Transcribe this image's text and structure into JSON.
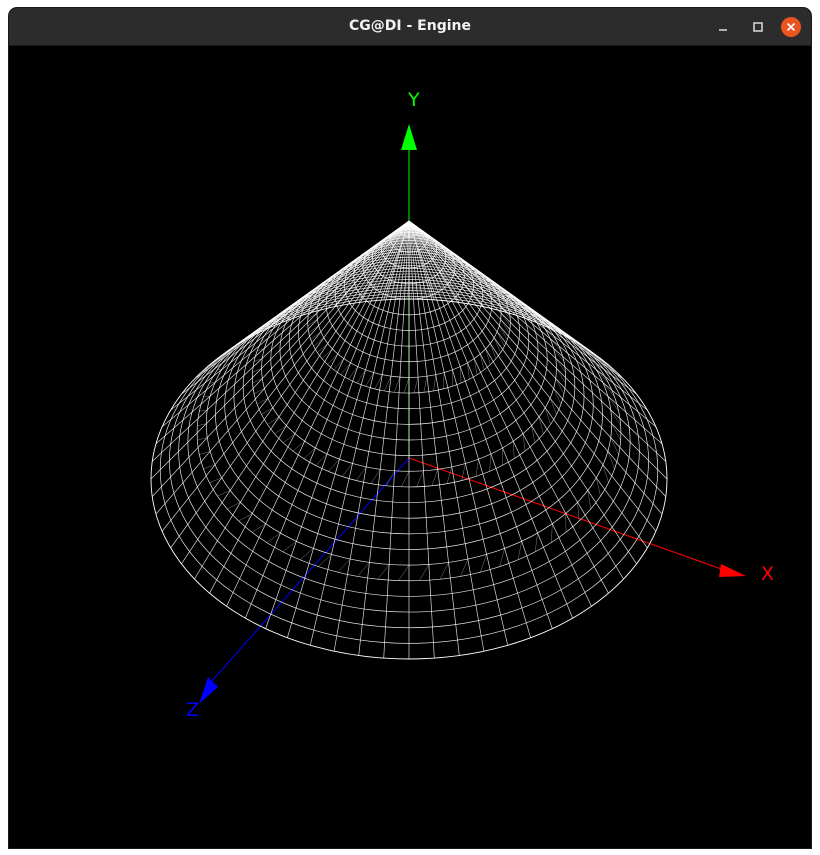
{
  "window": {
    "title": "CG@DI - Engine"
  },
  "titlebar_buttons": {
    "minimize_icon": "minimize-icon",
    "maximize_icon": "maximize-icon",
    "close_icon": "close-icon"
  },
  "scene": {
    "background": "#000000",
    "model": "cone",
    "render_mode": "wireframe",
    "wire_color": "#ffffff",
    "axes": {
      "x": {
        "label": "X",
        "color": "#ff0000"
      },
      "y": {
        "label": "Y",
        "color": "#00ff00"
      },
      "z": {
        "label": "Z",
        "color": "#0000ff"
      }
    }
  },
  "colors": {
    "titlebar": "#2c2c2c",
    "close_button": "#e95420"
  }
}
